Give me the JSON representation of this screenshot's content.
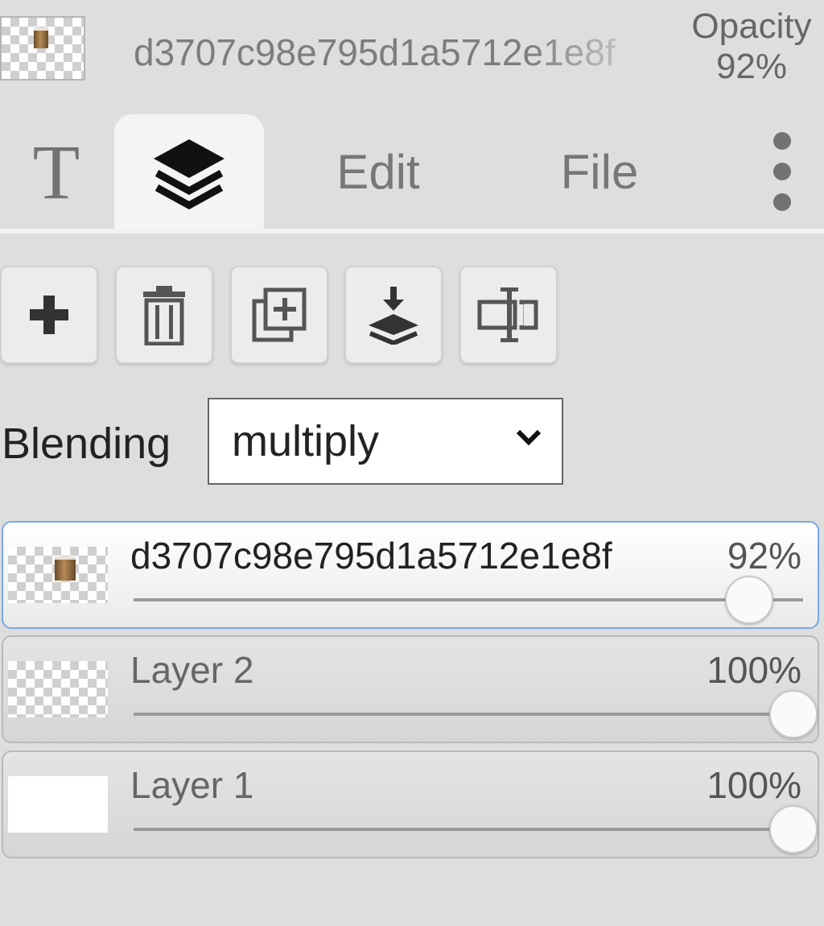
{
  "header": {
    "layer_name": "d3707c98e795d1a5712e1e8f",
    "opacity_label": "Opacity",
    "opacity_value": "92%"
  },
  "tabs": [
    {
      "icon": "text-icon",
      "label": "T"
    },
    {
      "icon": "layers-icon",
      "label": ""
    },
    {
      "label": "Edit"
    },
    {
      "label": "File"
    },
    {
      "icon": "more-vertical-icon",
      "label": ""
    }
  ],
  "toolbar": [
    {
      "icon": "plus-icon"
    },
    {
      "icon": "trash-icon"
    },
    {
      "icon": "duplicate-icon"
    },
    {
      "icon": "merge-down-icon"
    },
    {
      "icon": "rename-icon"
    }
  ],
  "blending": {
    "label": "Blending",
    "selected": "multiply"
  },
  "layers": [
    {
      "name": "d3707c98e795d1a5712e1e8f",
      "opacity_label": "92%",
      "opacity": 0.92,
      "selected": true
    },
    {
      "name": "Layer 2",
      "opacity_label": "100%",
      "opacity": 1.0,
      "selected": false
    },
    {
      "name": "Layer 1",
      "opacity_label": "100%",
      "opacity": 1.0,
      "selected": false
    }
  ],
  "colors": {
    "selected_border": "#7aa7e6",
    "panel_bg": "#dedede"
  }
}
